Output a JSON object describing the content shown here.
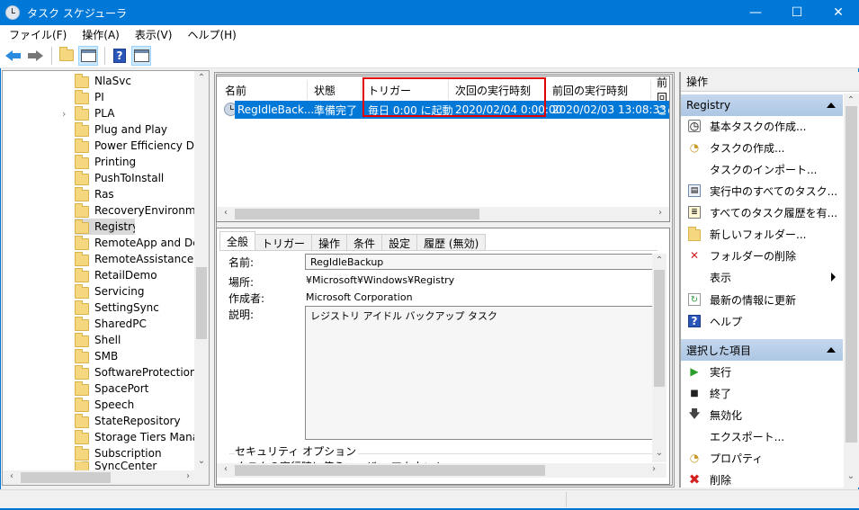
{
  "window": {
    "title": "タスク スケジューラ",
    "minimize_glyph": "—",
    "maximize_glyph": "☐",
    "close_glyph": "✕"
  },
  "menu": [
    {
      "label": "ファイル(F)"
    },
    {
      "label": "操作(A)"
    },
    {
      "label": "表示(V)"
    },
    {
      "label": "ヘルプ(H)"
    }
  ],
  "toolbar": {
    "help_glyph": "?"
  },
  "tree": {
    "items": [
      {
        "label": "NlaSvc"
      },
      {
        "label": "PI"
      },
      {
        "label": "PLA",
        "expandable": true
      },
      {
        "label": "Plug and Play"
      },
      {
        "label": "Power Efficiency Diag"
      },
      {
        "label": "Printing"
      },
      {
        "label": "PushToInstall"
      },
      {
        "label": "Ras"
      },
      {
        "label": "RecoveryEnvironmen"
      },
      {
        "label": "Registry",
        "selected": true
      },
      {
        "label": "RemoteApp and Desk"
      },
      {
        "label": "RemoteAssistance"
      },
      {
        "label": "RetailDemo"
      },
      {
        "label": "Servicing"
      },
      {
        "label": "SettingSync"
      },
      {
        "label": "SharedPC"
      },
      {
        "label": "Shell"
      },
      {
        "label": "SMB"
      },
      {
        "label": "SoftwareProtectionPl"
      },
      {
        "label": "SpacePort"
      },
      {
        "label": "Speech"
      },
      {
        "label": "StateRepository"
      },
      {
        "label": "Storage Tiers Manage"
      },
      {
        "label": "Subscription"
      },
      {
        "label": "SyncCenter"
      }
    ],
    "expander_glyph": "›"
  },
  "tasklist": {
    "columns": [
      "名前",
      "状態",
      "トリガー",
      "次回の実行時刻",
      "前回の実行時刻",
      "前回"
    ],
    "rows": [
      {
        "name": "RegIdleBack...",
        "status": "準備完了",
        "trigger": "毎日 0:00 に起動",
        "next_run": "2020/02/04 0:00:00",
        "last_run": "2020/02/03 13:08:33",
        "last_result": "この"
      }
    ]
  },
  "details": {
    "tabs": [
      "全般",
      "トリガー",
      "操作",
      "条件",
      "設定",
      "履歴 (無効)"
    ],
    "active_tab": "全般",
    "labels": {
      "name": "名前:",
      "location": "場所:",
      "author": "作成者:",
      "description": "説明:"
    },
    "values": {
      "name": "RegIdleBackup",
      "location": "¥Microsoft¥Windows¥Registry",
      "author": "Microsoft Corporation",
      "description": "レジストリ アイドル バックアップ タスク"
    },
    "security_options": "セキュリティ オプション",
    "security_sub": "タスクの実行時に使うユーザー アカウント:"
  },
  "actions": {
    "header": "操作",
    "sections": [
      {
        "title": "Registry",
        "items": [
          {
            "label": "基本タスクの作成...",
            "icon": "basic-task-icon"
          },
          {
            "label": "タスクの作成...",
            "icon": "create-task-icon"
          },
          {
            "label": "タスクのインポート...",
            "icon": ""
          },
          {
            "label": "実行中のすべてのタスク...",
            "icon": "running-tasks-icon"
          },
          {
            "label": "すべてのタスク履歴を有...",
            "icon": "history-icon"
          },
          {
            "label": "新しいフォルダー...",
            "icon": "new-folder-icon"
          },
          {
            "label": "フォルダーの削除",
            "icon": "delete-folder-icon"
          },
          {
            "label": "表示",
            "icon": "",
            "submenu": true
          },
          {
            "label": "最新の情報に更新",
            "icon": "refresh-icon"
          },
          {
            "label": "ヘルプ",
            "icon": "help-icon"
          }
        ]
      },
      {
        "title": "選択した項目",
        "items": [
          {
            "label": "実行",
            "icon": "run-icon"
          },
          {
            "label": "終了",
            "icon": "stop-icon"
          },
          {
            "label": "無効化",
            "icon": "disable-icon"
          },
          {
            "label": "エクスポート...",
            "icon": ""
          },
          {
            "label": "プロパティ",
            "icon": "properties-icon"
          },
          {
            "label": "削除",
            "icon": "delete-icon"
          }
        ]
      }
    ]
  },
  "colors": {
    "accent": "#0078d7",
    "selection": "#0078d7",
    "highlight_box": "#e00000",
    "section_header": "#b9cfe8"
  }
}
